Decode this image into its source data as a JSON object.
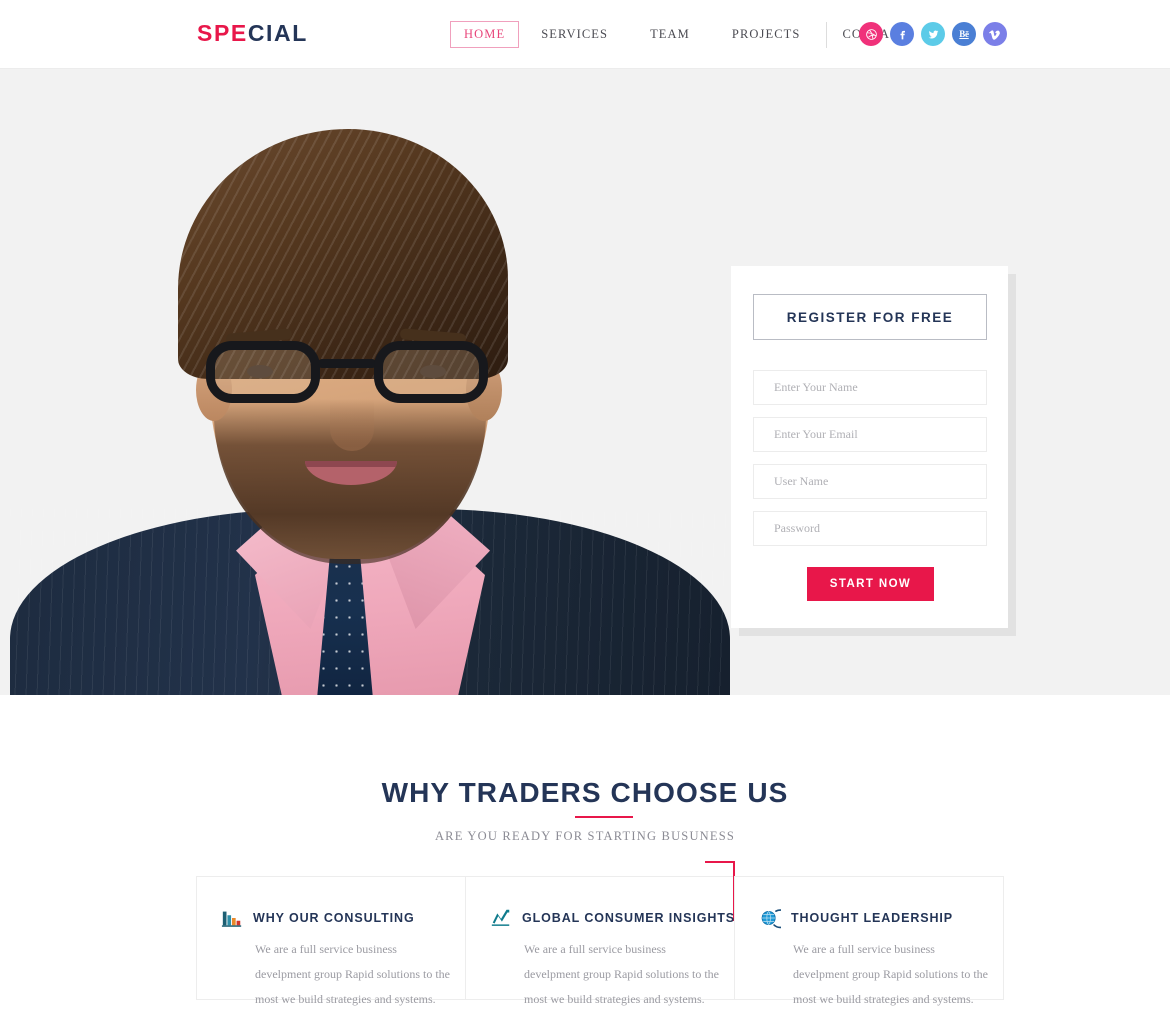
{
  "colors": {
    "accent_pink": "#e8174a",
    "nav_active": "#e8467b",
    "dark_navy": "#243557",
    "hero_bg": "#f2f2f2",
    "body_text": "#9b9ba2"
  },
  "header": {
    "logo_accent": "SPE",
    "logo_rest": "CIAL",
    "nav": [
      {
        "label": "HOME",
        "active": true
      },
      {
        "label": "SERVICES",
        "active": false
      },
      {
        "label": "TEAM",
        "active": false
      },
      {
        "label": "PROJECTS",
        "active": false
      },
      {
        "label": "CONTACT",
        "active": false
      }
    ],
    "socials": [
      {
        "name": "dribbble-icon",
        "glyph": "◎",
        "color": "#f0317a"
      },
      {
        "name": "facebook-icon",
        "glyph": "f",
        "color": "#5a7fe0"
      },
      {
        "name": "twitter-icon",
        "glyph": "ᵗ",
        "color": "#5ccbe8"
      },
      {
        "name": "behance-icon",
        "glyph": "Bē",
        "color": "#4a7fd4"
      },
      {
        "name": "vimeo-icon",
        "glyph": "v",
        "color": "#7b7fe8"
      }
    ]
  },
  "hero": {
    "image_alt": "businessman-portrait"
  },
  "register": {
    "title": "REGISTER FOR FREE",
    "fields": [
      {
        "name": "name",
        "placeholder": "Enter Your Name",
        "value": ""
      },
      {
        "name": "email",
        "placeholder": "Enter Your Email",
        "value": ""
      },
      {
        "name": "username",
        "placeholder": "User Name",
        "value": ""
      },
      {
        "name": "password",
        "placeholder": "Password",
        "value": ""
      }
    ],
    "submit_label": "START NOW"
  },
  "why": {
    "title": "WHY TRADERS CHOOSE US",
    "subtitle": "ARE YOU READY FOR STARTING BUSUNESS",
    "cards": [
      {
        "icon": "bar-chart-icon",
        "title": "WHY OUR CONSULTING",
        "body": "We are a full service business develpment group Rapid solutions to the most we build strategies and systems.",
        "accent": false
      },
      {
        "icon": "trending-up-icon",
        "title": "GLOBAL CONSUMER INSIGHTS",
        "body": "We are a full service business develpment group Rapid solutions to the most we build strategies and systems.",
        "accent": true
      },
      {
        "icon": "globe-icon",
        "title": "THOUGHT LEADERSHIP",
        "body": "We are a full service business develpment group Rapid solutions to the most we build strategies and systems.",
        "accent": false
      }
    ]
  }
}
